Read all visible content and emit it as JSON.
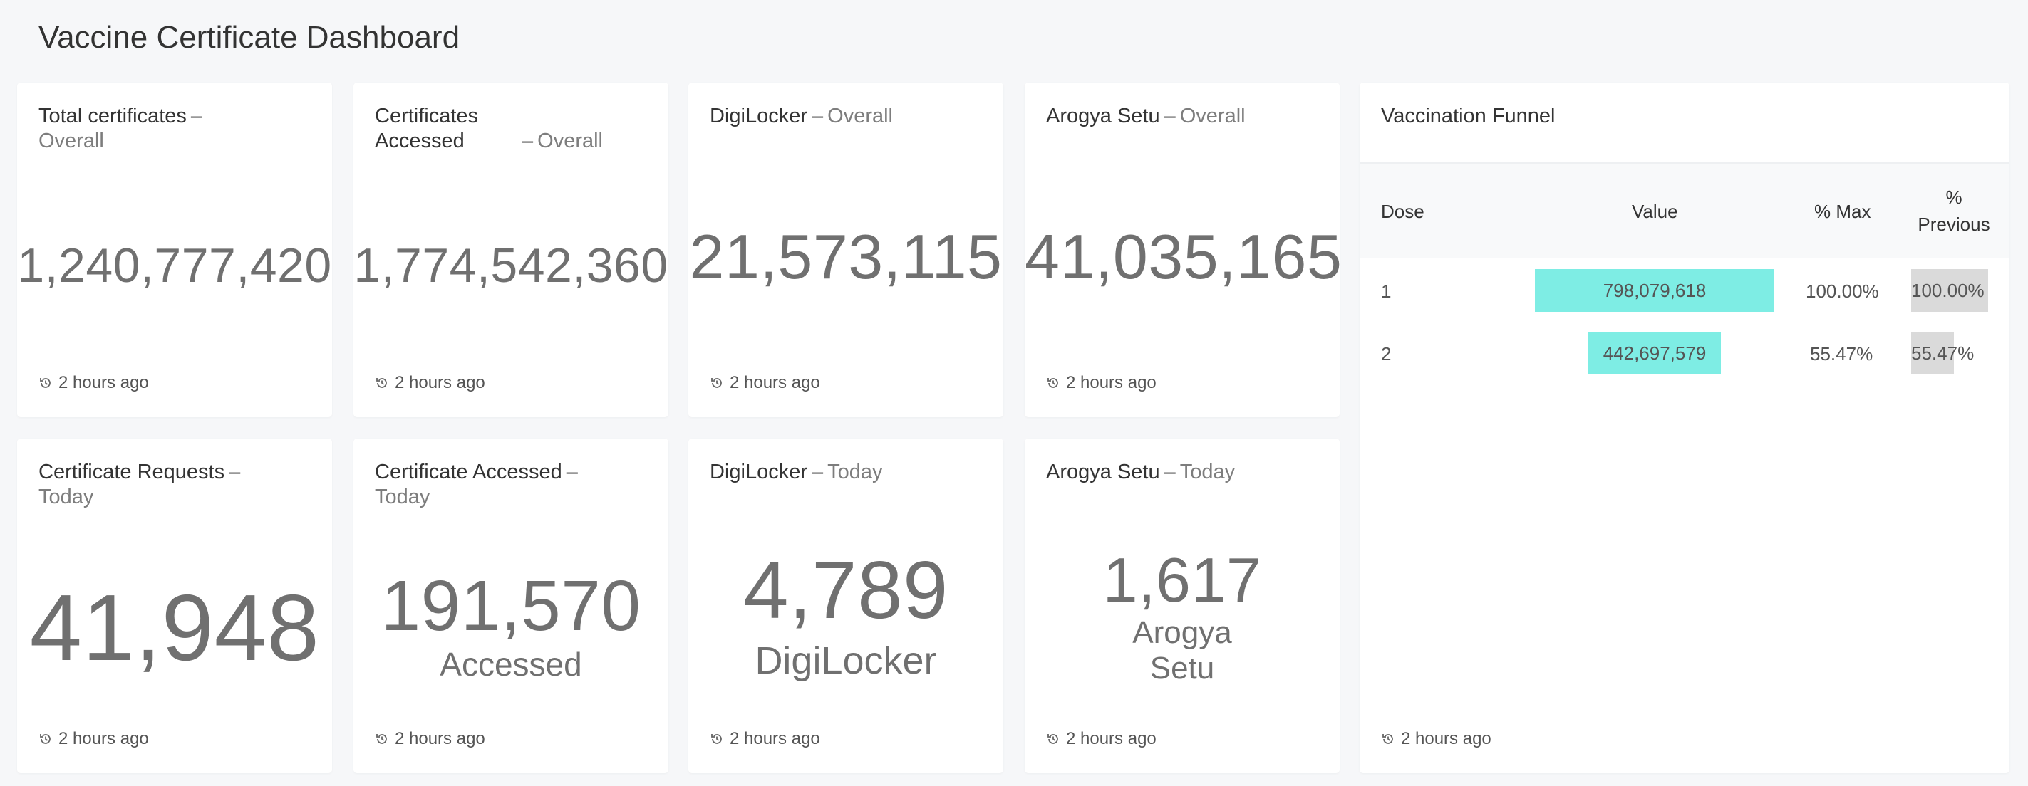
{
  "page": {
    "title": "Vaccine Certificate Dashboard"
  },
  "cards": {
    "total_overall": {
      "title": "Total certificates",
      "sub": "Overall",
      "value": "1,240,777,420",
      "updated": "2 hours ago"
    },
    "accessed_overall": {
      "title": "Certificates Accessed",
      "sub": "Overall",
      "value": "1,774,542,360",
      "updated": "2 hours ago"
    },
    "digilocker_overall": {
      "title": "DigiLocker",
      "sub": "Overall",
      "value": "21,573,115",
      "updated": "2 hours ago"
    },
    "arogya_overall": {
      "title": "Arogya Setu",
      "sub": "Overall",
      "value": "41,035,165",
      "updated": "2 hours ago"
    },
    "requests_today": {
      "title": "Certificate Requests",
      "sub": "Today",
      "value": "41,948",
      "updated": "2 hours ago"
    },
    "accessed_today": {
      "title": "Certificate Accessed",
      "sub": "Today",
      "value": "191,570",
      "caption": "Accessed",
      "updated": "2 hours ago"
    },
    "digilocker_today": {
      "title": "DigiLocker",
      "sub": "Today",
      "value": "4,789",
      "caption": "DigiLocker",
      "updated": "2 hours ago"
    },
    "arogya_today": {
      "title": "Arogya Setu",
      "sub": "Today",
      "value": "1,617",
      "caption_line1": "Arogya",
      "caption_line2": "Setu",
      "updated": "2 hours ago"
    }
  },
  "funnel": {
    "title": "Vaccination Funnel",
    "columns": {
      "dose": "Dose",
      "value": "Value",
      "pct_max": "% Max",
      "pct_prev_1": "%",
      "pct_prev_2": "Previous"
    },
    "rows": [
      {
        "dose": "1",
        "value": "798,079,618",
        "value_fraction": 1.0,
        "pct_max": "100.00%",
        "pct_prev": "100.00%",
        "prev_fraction": 1.0
      },
      {
        "dose": "2",
        "value": "442,697,579",
        "value_fraction": 0.5547,
        "pct_max": "55.47%",
        "pct_prev": "55.47%",
        "prev_fraction": 0.5547
      }
    ],
    "updated": "2 hours ago"
  },
  "colors": {
    "value_bar": "#7eede4",
    "prev_bar": "#dadada",
    "muted_text": "#707070"
  },
  "icons": {
    "updated": "history-clock-icon"
  }
}
